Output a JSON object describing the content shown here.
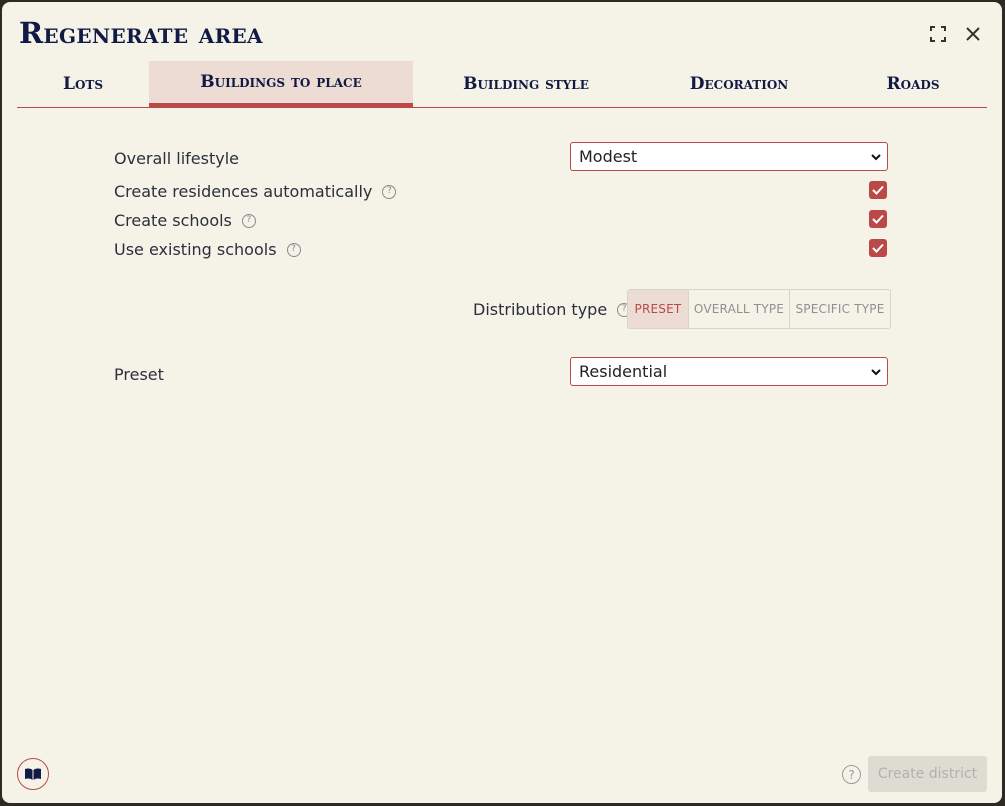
{
  "title": "Regenerate area",
  "tabs": [
    {
      "label": "Lots"
    },
    {
      "label": "Buildings to place"
    },
    {
      "label": "Building style"
    },
    {
      "label": "Decoration"
    },
    {
      "label": "Roads"
    }
  ],
  "active_tab": "Buildings to place",
  "rows": {
    "lifestyle": {
      "label": "Overall lifestyle",
      "value": "Modest"
    },
    "residences": {
      "label": "Create residences automatically",
      "checked": true
    },
    "schools": {
      "label": "Create schools",
      "checked": true
    },
    "existing_schools": {
      "label": "Use existing schools",
      "checked": true
    },
    "distribution": {
      "label": "Distribution type",
      "options": [
        "PRESET",
        "OVERALL TYPE",
        "SPECIFIC TYPE"
      ],
      "selected": "PRESET"
    },
    "preset": {
      "label": "Preset",
      "value": "Residential"
    }
  },
  "footer": {
    "help_glyph": "?",
    "create_label": "Create district"
  },
  "icons": {
    "maximize": "maximize-icon",
    "close": "close-icon",
    "help": "help-icon",
    "book": "book-icon"
  },
  "colors": {
    "accent": "#b94a48",
    "background": "#f5f3e8",
    "title": "#111a44"
  }
}
